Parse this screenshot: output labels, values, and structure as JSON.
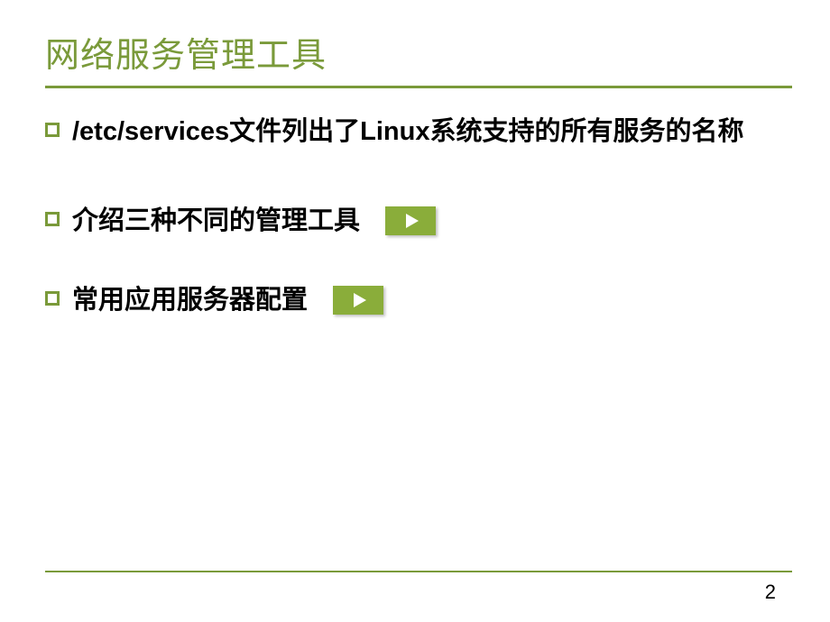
{
  "title": "网络服务管理工具",
  "bullets": [
    {
      "text": "/etc/services文件列出了Linux系统支持的所有服务的名称",
      "hasPlayButton": false
    },
    {
      "text": "介绍三种不同的管理工具",
      "hasPlayButton": true
    },
    {
      "text": "常用应用服务器配置",
      "hasPlayButton": true
    }
  ],
  "pageNumber": "2"
}
